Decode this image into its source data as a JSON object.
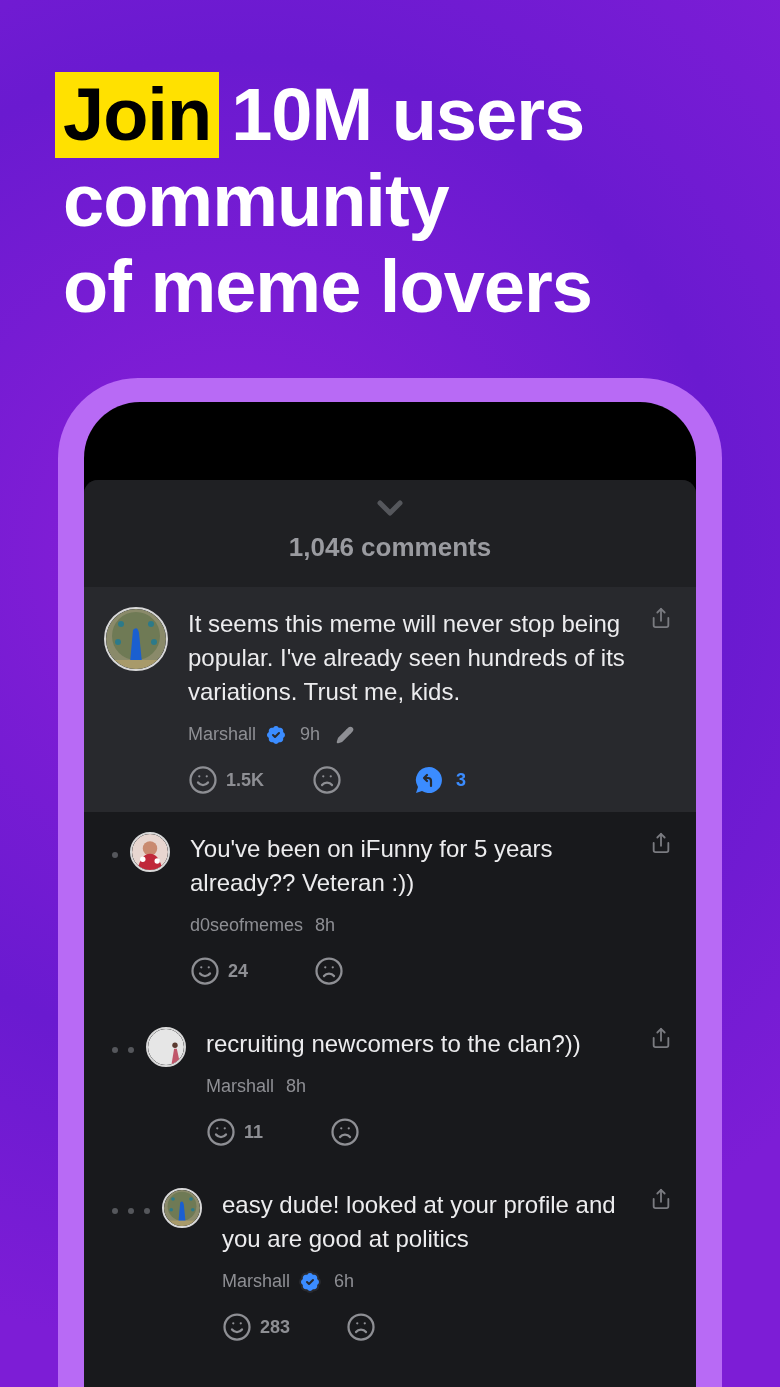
{
  "headline": {
    "highlight": "Join",
    "lines": [
      "10M users",
      "community",
      "of meme lovers"
    ]
  },
  "sheet": {
    "title": "1,046 comments"
  },
  "comments": [
    {
      "text": "It seems this meme will never stop being popular. I've already seen hundreds of its variations. Trust me, kids.",
      "author": "Marshall",
      "verified": true,
      "time": "9h",
      "edited": true,
      "highlighted": true,
      "likes": "1.5K",
      "replies": "3",
      "children": [
        {
          "text": "You've been on iFunny for 5 years already?? Veteran :))",
          "author": "d0seofmemes",
          "verified": false,
          "time": "8h",
          "edited": false,
          "highlighted": false,
          "likes": "24",
          "children": [
            {
              "text": "recruiting newcomers to the clan?))",
              "author": "Marshall",
              "verified": false,
              "time": "8h",
              "edited": false,
              "highlighted": false,
              "likes": "11",
              "children": [
                {
                  "text": "easy dude! looked at your profile and you are good at politics",
                  "author": "Marshall",
                  "verified": true,
                  "time": "6h",
                  "edited": false,
                  "highlighted": false,
                  "likes": "283"
                }
              ]
            }
          ]
        }
      ]
    }
  ]
}
